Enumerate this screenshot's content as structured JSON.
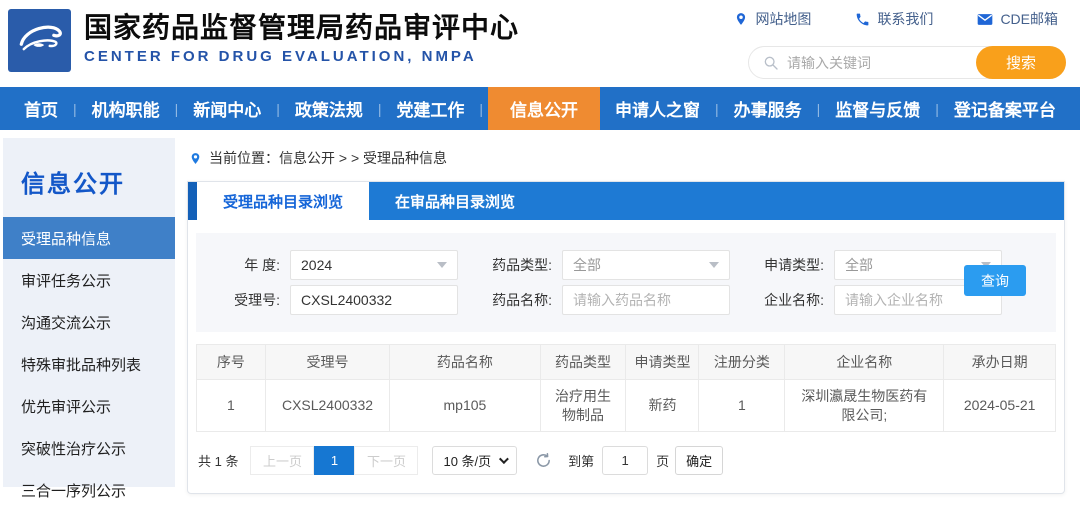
{
  "header": {
    "title": "国家药品监督管理局药品审评中心",
    "subtitle": "CENTER FOR DRUG EVALUATION, NMPA",
    "links": [
      {
        "icon": "location-pin-icon",
        "label": "网站地图"
      },
      {
        "icon": "phone-icon",
        "label": "联系我们"
      },
      {
        "icon": "envelope-icon",
        "label": "CDE邮箱"
      }
    ],
    "search": {
      "placeholder": "请输入关键词",
      "button": "搜索"
    }
  },
  "nav": {
    "items": [
      {
        "label": "首页",
        "active": false
      },
      {
        "label": "机构职能",
        "active": false
      },
      {
        "label": "新闻中心",
        "active": false
      },
      {
        "label": "政策法规",
        "active": false
      },
      {
        "label": "党建工作",
        "active": false
      },
      {
        "label": "信息公开",
        "active": true
      },
      {
        "label": "申请人之窗",
        "active": false
      },
      {
        "label": "办事服务",
        "active": false
      },
      {
        "label": "监督与反馈",
        "active": false
      },
      {
        "label": "登记备案平台",
        "active": false
      }
    ]
  },
  "sidebar": {
    "title": "信息公开",
    "items": [
      {
        "label": "受理品种信息",
        "active": true
      },
      {
        "label": "审评任务公示",
        "active": false
      },
      {
        "label": "沟通交流公示",
        "active": false
      },
      {
        "label": "特殊审批品种列表",
        "active": false
      },
      {
        "label": "优先审评公示",
        "active": false
      },
      {
        "label": "突破性治疗公示",
        "active": false
      },
      {
        "label": "三合一序列公示",
        "active": false
      }
    ]
  },
  "breadcrumb": {
    "text": "当前位置：信息公开 > > 受理品种信息"
  },
  "tabs": [
    {
      "label": "受理品种目录浏览",
      "active": true
    },
    {
      "label": "在审品种目录浏览",
      "active": false
    }
  ],
  "filters": {
    "year": {
      "label": "年 度:",
      "value": "2024"
    },
    "drug_type": {
      "label": "药品类型:",
      "value": "全部"
    },
    "apply_type": {
      "label": "申请类型:",
      "value": "全部"
    },
    "acceptance_no": {
      "label": "受理号:",
      "value": "CXSL2400332"
    },
    "drug_name": {
      "label": "药品名称:",
      "placeholder": "请输入药品名称"
    },
    "company_name": {
      "label": "企业名称:",
      "placeholder": "请输入企业名称"
    },
    "query_button": "查询"
  },
  "table": {
    "headers": [
      "序号",
      "受理号",
      "药品名称",
      "药品类型",
      "申请类型",
      "注册分类",
      "企业名称",
      "承办日期"
    ],
    "rows": [
      [
        "1",
        "CXSL2400332",
        "mp105",
        "治疗用生物制品",
        "新药",
        "1",
        "深圳瀛晟生物医药有限公司;",
        "2024-05-21"
      ]
    ]
  },
  "pagination": {
    "total": "共 1 条",
    "prev": "上一页",
    "page": "1",
    "next": "下一页",
    "page_size": "10 条/页",
    "goto_prefix": "到第",
    "goto_value": "1",
    "goto_suffix": "页",
    "confirm": "确定"
  },
  "colors": {
    "nav_blue": "#2170c7",
    "tab_blue": "#1e7ad4",
    "highlight_orange": "#ef8b31",
    "search_orange": "#f9a01b",
    "query_blue": "#2b9cf0",
    "pagination_active_blue": "#1677d2",
    "sidebar_active_blue": "#3f80c8",
    "brand_blue": "#2453a8"
  }
}
